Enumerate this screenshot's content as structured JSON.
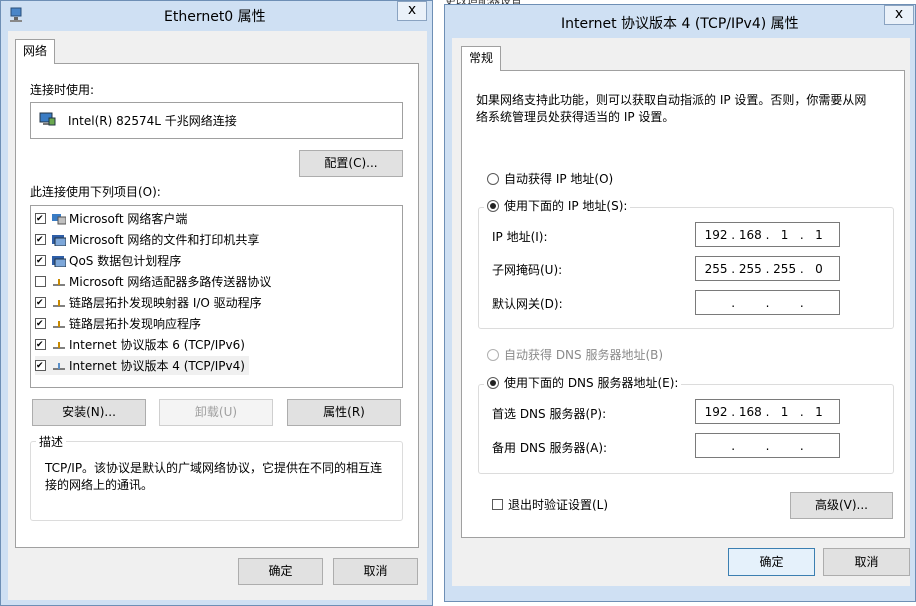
{
  "win1": {
    "title": "Ethernet0 属性",
    "close_label": "x",
    "tab_label": "网络",
    "connect_using_label": "连接时使用:",
    "adapter_name": "Intel(R) 82574L 千兆网络连接",
    "configure_label": "配置(C)...",
    "items_label": "此连接使用下列项目(O):",
    "items": [
      {
        "label": "Microsoft 网络客户端",
        "checked": true
      },
      {
        "label": "Microsoft 网络的文件和打印机共享",
        "checked": true
      },
      {
        "label": "QoS 数据包计划程序",
        "checked": true
      },
      {
        "label": "Microsoft 网络适配器多路传送器协议",
        "checked": false
      },
      {
        "label": "链路层拓扑发现映射器 I/O 驱动程序",
        "checked": true
      },
      {
        "label": "链路层拓扑发现响应程序",
        "checked": true
      },
      {
        "label": "Internet 协议版本 6 (TCP/IPv6)",
        "checked": true
      },
      {
        "label": "Internet 协议版本 4 (TCP/IPv4)",
        "checked": true
      }
    ],
    "install_label": "安装(N)...",
    "uninstall_label": "卸载(U)",
    "properties_label": "属性(R)",
    "description_legend": "描述",
    "description_text_1": "TCP/IP。该协议是默认的广域网络协议，它提供在不同的相互连",
    "description_text_2": "接的网络上的通讯。",
    "ok_label": "确定",
    "cancel_label": "取消"
  },
  "win2": {
    "title": "Internet 协议版本 4 (TCP/IPv4) 属性",
    "tab_label": "常规",
    "intro_1": "如果网络支持此功能，则可以获取自动指派的 IP 设置。否则，你需要从网",
    "intro_2": "络系统管理员处获得适当的 IP 设置。",
    "auto_ip_label": "自动获得 IP 地址(O)",
    "manual_ip_label": "使用下面的 IP 地址(S):",
    "ip_label": "IP 地址(I):",
    "ip_value": [
      "192",
      "168",
      "1",
      "1"
    ],
    "mask_label": "子网掩码(U):",
    "mask_value": [
      "255",
      "255",
      "255",
      "0"
    ],
    "gateway_label": "默认网关(D):",
    "gateway_value": [
      "",
      "",
      "",
      ""
    ],
    "auto_dns_label": "自动获得 DNS 服务器地址(B)",
    "manual_dns_label": "使用下面的 DNS 服务器地址(E):",
    "preferred_dns_label": "首选 DNS 服务器(P):",
    "preferred_dns_value": [
      "192",
      "168",
      "1",
      "1"
    ],
    "alternate_dns_label": "备用 DNS 服务器(A):",
    "alternate_dns_value": [
      "",
      "",
      "",
      ""
    ],
    "validate_label": "退出时验证设置(L)",
    "advanced_label": "高级(V)...",
    "ok_label": "确定",
    "cancel_label": "取消"
  },
  "background_partial_text": "更改适配器设置"
}
